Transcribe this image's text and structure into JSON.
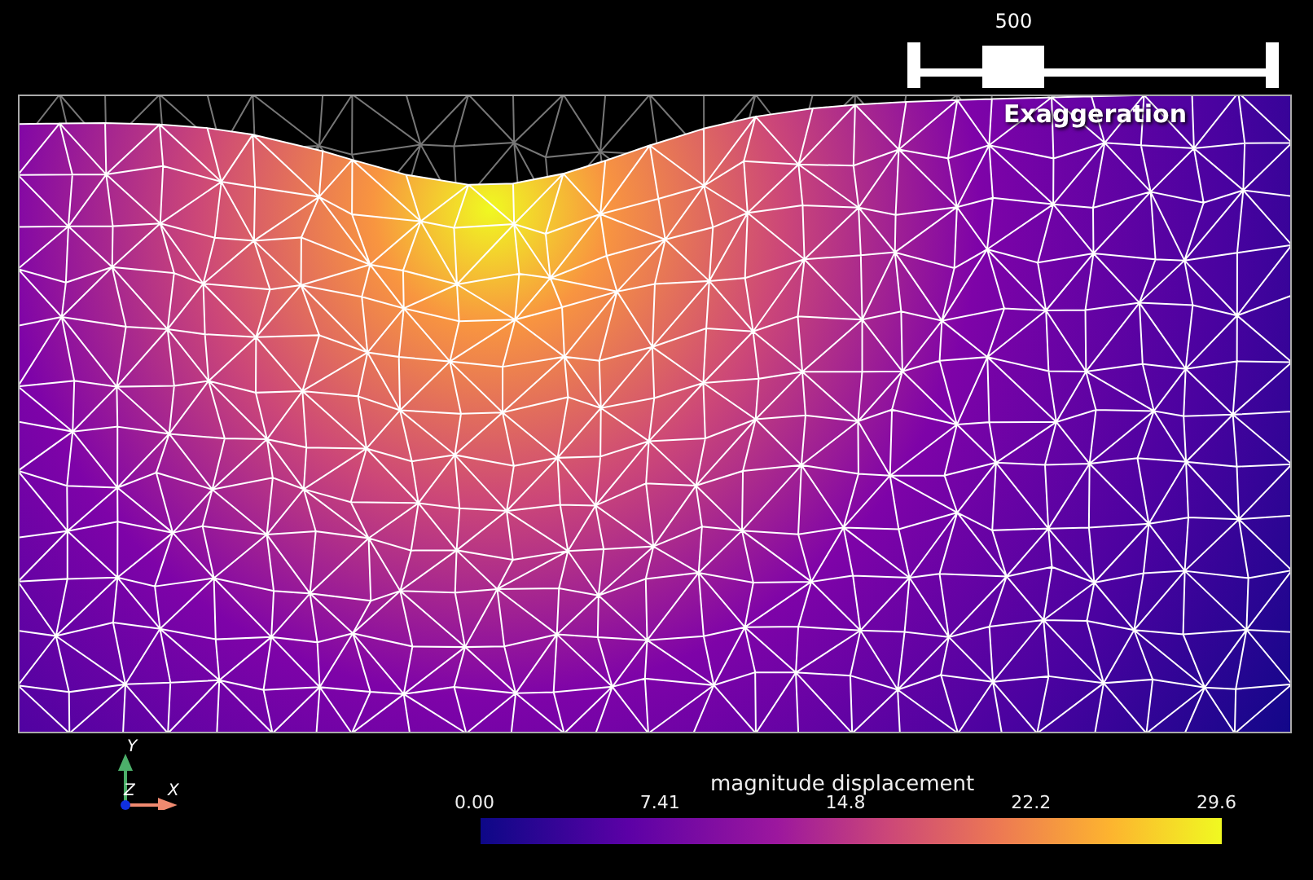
{
  "slider": {
    "value": "500",
    "level": 0.27,
    "label": "Exaggeration"
  },
  "orientation_axes": {
    "y": "Y",
    "z": "Z",
    "x": "X"
  },
  "color_bar": {
    "title": "magnitude displacement",
    "ticks": [
      "0.00",
      "7.41",
      "14.8",
      "22.2",
      "29.6"
    ]
  }
}
